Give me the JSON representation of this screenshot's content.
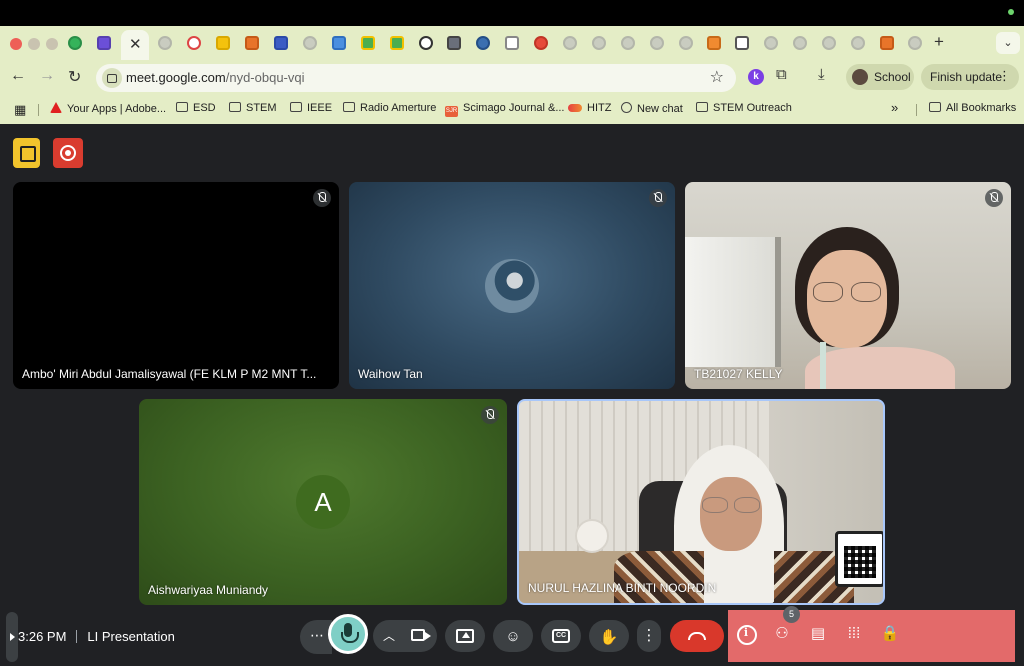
{
  "browser": {
    "url_host": "meet.google.com",
    "url_path": "/nyd-obqu-vqi",
    "profile_label": "School",
    "update_label": "Finish update",
    "extension_letter": "k",
    "bookmarks": [
      {
        "label": "Your Apps | Adobe...",
        "icon": "adobe-icon"
      },
      {
        "label": "ESD",
        "icon": "folder-icon"
      },
      {
        "label": "STEM",
        "icon": "folder-icon"
      },
      {
        "label": "IEEE",
        "icon": "folder-icon"
      },
      {
        "label": "Radio Amerture",
        "icon": "folder-icon"
      },
      {
        "label": "Scimago Journal &...",
        "icon": "sjr-icon"
      },
      {
        "label": "HITZ",
        "icon": "hitz-icon"
      },
      {
        "label": "New chat",
        "icon": "chatgpt-icon"
      },
      {
        "label": "STEM Outreach",
        "icon": "folder-icon"
      }
    ],
    "bookmarks_overflow": "»",
    "all_bookmarks_label": "All Bookmarks",
    "tab_close": "✕",
    "new_tab": "+"
  },
  "meet": {
    "participants": [
      {
        "name": "Ambo' Miri Abdul Jamalisyawal (FE KLM P M2 MNT T...",
        "muted": true
      },
      {
        "name": "Waihow Tan",
        "muted": true
      },
      {
        "name": "TB21027 KELLY",
        "muted": true
      },
      {
        "name": "Aishwariyaa Muniandy",
        "muted": true,
        "avatar_letter": "A"
      },
      {
        "name": "NURUL HAZLINA BINTI NOORDIN",
        "muted": false
      }
    ],
    "time": "3:26 PM",
    "meeting_title": "LI Presentation",
    "participant_count": "5",
    "more_label": "⋯",
    "colors": {
      "background": "#202124",
      "leave": "#d9382b",
      "mic_active": "#7fcfc6",
      "side_panel": "#e36a6a",
      "browser_frame": "#e4edc6"
    }
  }
}
